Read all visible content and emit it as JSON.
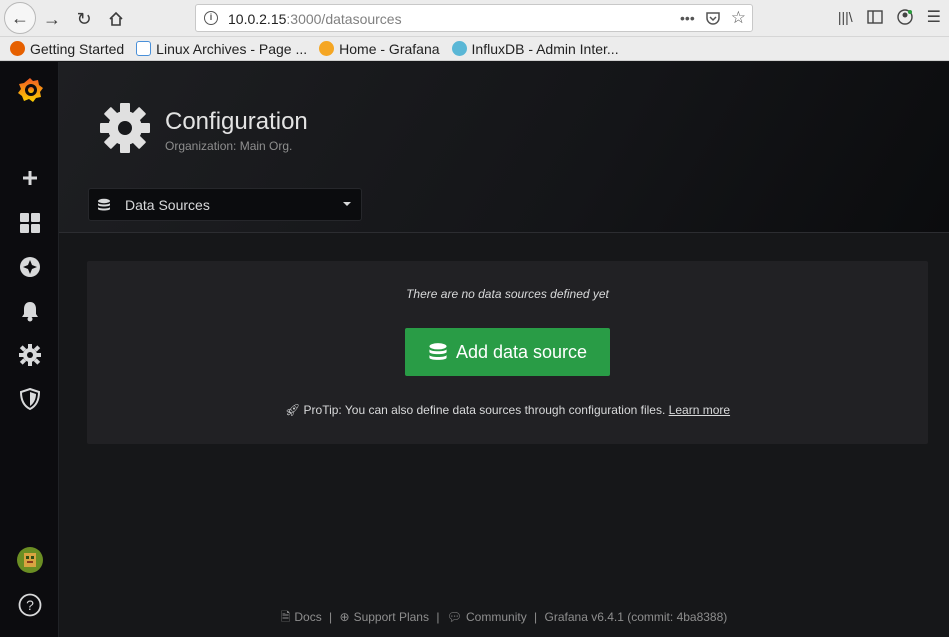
{
  "browser": {
    "url_host": "10.0.2.15",
    "url_path": ":3000/datasources",
    "bookmarks": [
      {
        "label": "Getting Started",
        "color": "#e66000"
      },
      {
        "label": "Linux Archives - Page ...",
        "color": "#4a90d9"
      },
      {
        "label": "Home - Grafana",
        "color": "#f5a623"
      },
      {
        "label": "InfluxDB - Admin Inter...",
        "color": "#5ab7d6"
      }
    ]
  },
  "header": {
    "title": "Configuration",
    "subtitle": "Organization: Main Org.",
    "select_value": "Data Sources"
  },
  "empty_state": {
    "message": "There are no data sources defined yet",
    "button_label": "Add data source",
    "protip_text": "ProTip: You can also define data sources through configuration files.",
    "learn_more": "Learn more"
  },
  "footer": {
    "docs": "Docs",
    "support": "Support Plans",
    "community": "Community",
    "version": "Grafana v6.4.1 (commit: 4ba8388)"
  },
  "colors": {
    "accent_green": "#299c46",
    "grafana_orange": "#f46800"
  }
}
